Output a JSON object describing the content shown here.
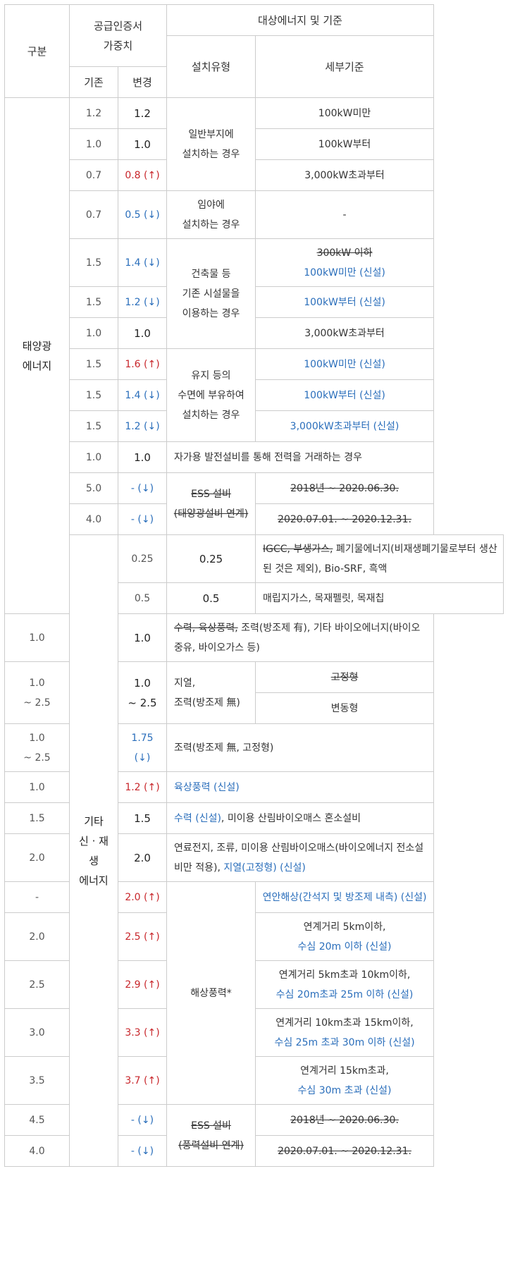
{
  "header": {
    "category": "구분",
    "weight_line1": "공급인증서",
    "weight_line2": "가중치",
    "target": "대상에너지 및 기준",
    "old": "기존",
    "new": "변경",
    "install_type": "설치유형",
    "detail": "세부기준"
  },
  "solar": {
    "label_line1": "태양광",
    "label_line2": "에너지",
    "type_general_1": "일반부지에",
    "type_general_2": "설치하는 경우",
    "type_forest_1": "임야에",
    "type_forest_2": "설치하는 경우",
    "type_building_1": "건축물 등",
    "type_building_2": "기존 시설물을",
    "type_building_3": "이용하는 경우",
    "type_water_1": "유지 등의",
    "type_water_2": "수면에 부유하여",
    "type_water_3": "설치하는 경우",
    "type_self": "자가용 발전설비를 통해 전력을 거래하는 경우",
    "type_ess_1": "ESS 설비",
    "type_ess_2": "(태양광설비 연계)",
    "rows": [
      {
        "old": "1.2",
        "new": "1.2",
        "detail": "100kW미만"
      },
      {
        "old": "1.0",
        "new": "1.0",
        "detail": "100kW부터"
      },
      {
        "old": "0.7",
        "new": "0.8 (↑)",
        "detail": "3,000kW초과부터"
      },
      {
        "old": "0.7",
        "new": "0.5 (↓)",
        "detail": "-"
      },
      {
        "old": "1.5",
        "new": "1.4 (↓)",
        "detail_strike": "300kW 이하",
        "detail": "100kW미만 (신설)"
      },
      {
        "old": "1.5",
        "new": "1.2 (↓)",
        "detail": "100kW부터 (신설)"
      },
      {
        "old": "1.0",
        "new": "1.0",
        "detail": "3,000kW초과부터"
      },
      {
        "old": "1.5",
        "new": "1.6 (↑)",
        "detail": "100kW미만 (신설)"
      },
      {
        "old": "1.5",
        "new": "1.4 (↓)",
        "detail": "100kW부터 (신설)"
      },
      {
        "old": "1.5",
        "new": "1.2 (↓)",
        "detail": "3,000kW초과부터 (신설)"
      },
      {
        "old": "1.0",
        "new": "1.0"
      },
      {
        "old": "5.0",
        "new": "- (↓)",
        "detail": "2018년 ~ 2020.06.30."
      },
      {
        "old": "4.0",
        "new": "- (↓)",
        "detail": "2020.07.01. ~ 2020.12.31."
      }
    ]
  },
  "other": {
    "label_line1": "기타",
    "label_line2": "신 · 재생",
    "label_line3": "에너지",
    "r1_strike": "IGCC, 부생가스,",
    "r1_text": " 폐기물에너지(비재생폐기물로부터 생산된 것은 제외), Bio-SRF, 흑액",
    "r2_text": "매립지가스, 목재펠릿, 목재칩",
    "r3_strike": "수력, 육상풍력,",
    "r3_text": " 조력(방조제 有), 기타 바이오에너지(바이오중유, 바이오가스 등)",
    "r4_type_1": "지열,",
    "r4_type_2": "조력(방조제 無)",
    "r4_detail_a": "고정형",
    "r4_detail_b": "변동형",
    "r5_text": "조력(방조제 無, 고정형)",
    "r6_text": "육상풍력 (신설)",
    "r7_blue": "수력 (신설)",
    "r7_text": ", 미이용 산림바이오매스 혼소설비",
    "r8_text": "연료전지, 조류, 미이용 산림바이오매스(바이오에너지 전소설비만 적용), ",
    "r8_blue": "지열(고정형) (신설)",
    "offshore": "해상풍력*",
    "off1": "연안해상(간석지 및 방조제 내측)  (신설)",
    "off2_a": "연계거리 5km이하,",
    "off2_b": "수심 20m 이하 (신설)",
    "off3_a": "연계거리 5km초과 10km이하,",
    "off3_b": "수심 20m초과 25m 이하 (신설)",
    "off4_a": "연계거리 10km초과 15km이하,",
    "off4_b": "수심 25m 초과 30m 이하 (신설)",
    "off5_a": "연계거리 15km초과,",
    "off5_b": "수심 30m 초과 (신설)",
    "ess_1": "ESS 설비",
    "ess_2": "(풍력설비 연계)",
    "ess_d1": "2018년 ~ 2020.06.30.",
    "ess_d2": "2020.07.01. ~ 2020.12.31.",
    "rows": [
      {
        "old": "0.25",
        "new": "0.25"
      },
      {
        "old": "0.5",
        "new": "0.5"
      },
      {
        "old": "1.0",
        "new": "1.0"
      },
      {
        "old_1": "1.0",
        "old_2": "~ 2.5",
        "new_1": "1.0",
        "new_2": "~ 2.5"
      },
      {
        "old_1": "1.0",
        "old_2": "~ 2.5",
        "new": "1.75 (↓)"
      },
      {
        "old": "1.0",
        "new": "1.2 (↑)"
      },
      {
        "old": "1.5",
        "new": "1.5"
      },
      {
        "old": "2.0",
        "new": "2.0"
      },
      {
        "old": "-",
        "new": "2.0 (↑)"
      },
      {
        "old": "2.0",
        "new": "2.5 (↑)"
      },
      {
        "old": "2.5",
        "new": "2.9 (↑)"
      },
      {
        "old": "3.0",
        "new": "3.3 (↑)"
      },
      {
        "old": "3.5",
        "new": "3.7 (↑)"
      },
      {
        "old": "4.5",
        "new": "- (↓)"
      },
      {
        "old": "4.0",
        "new": "- (↓)"
      }
    ]
  }
}
